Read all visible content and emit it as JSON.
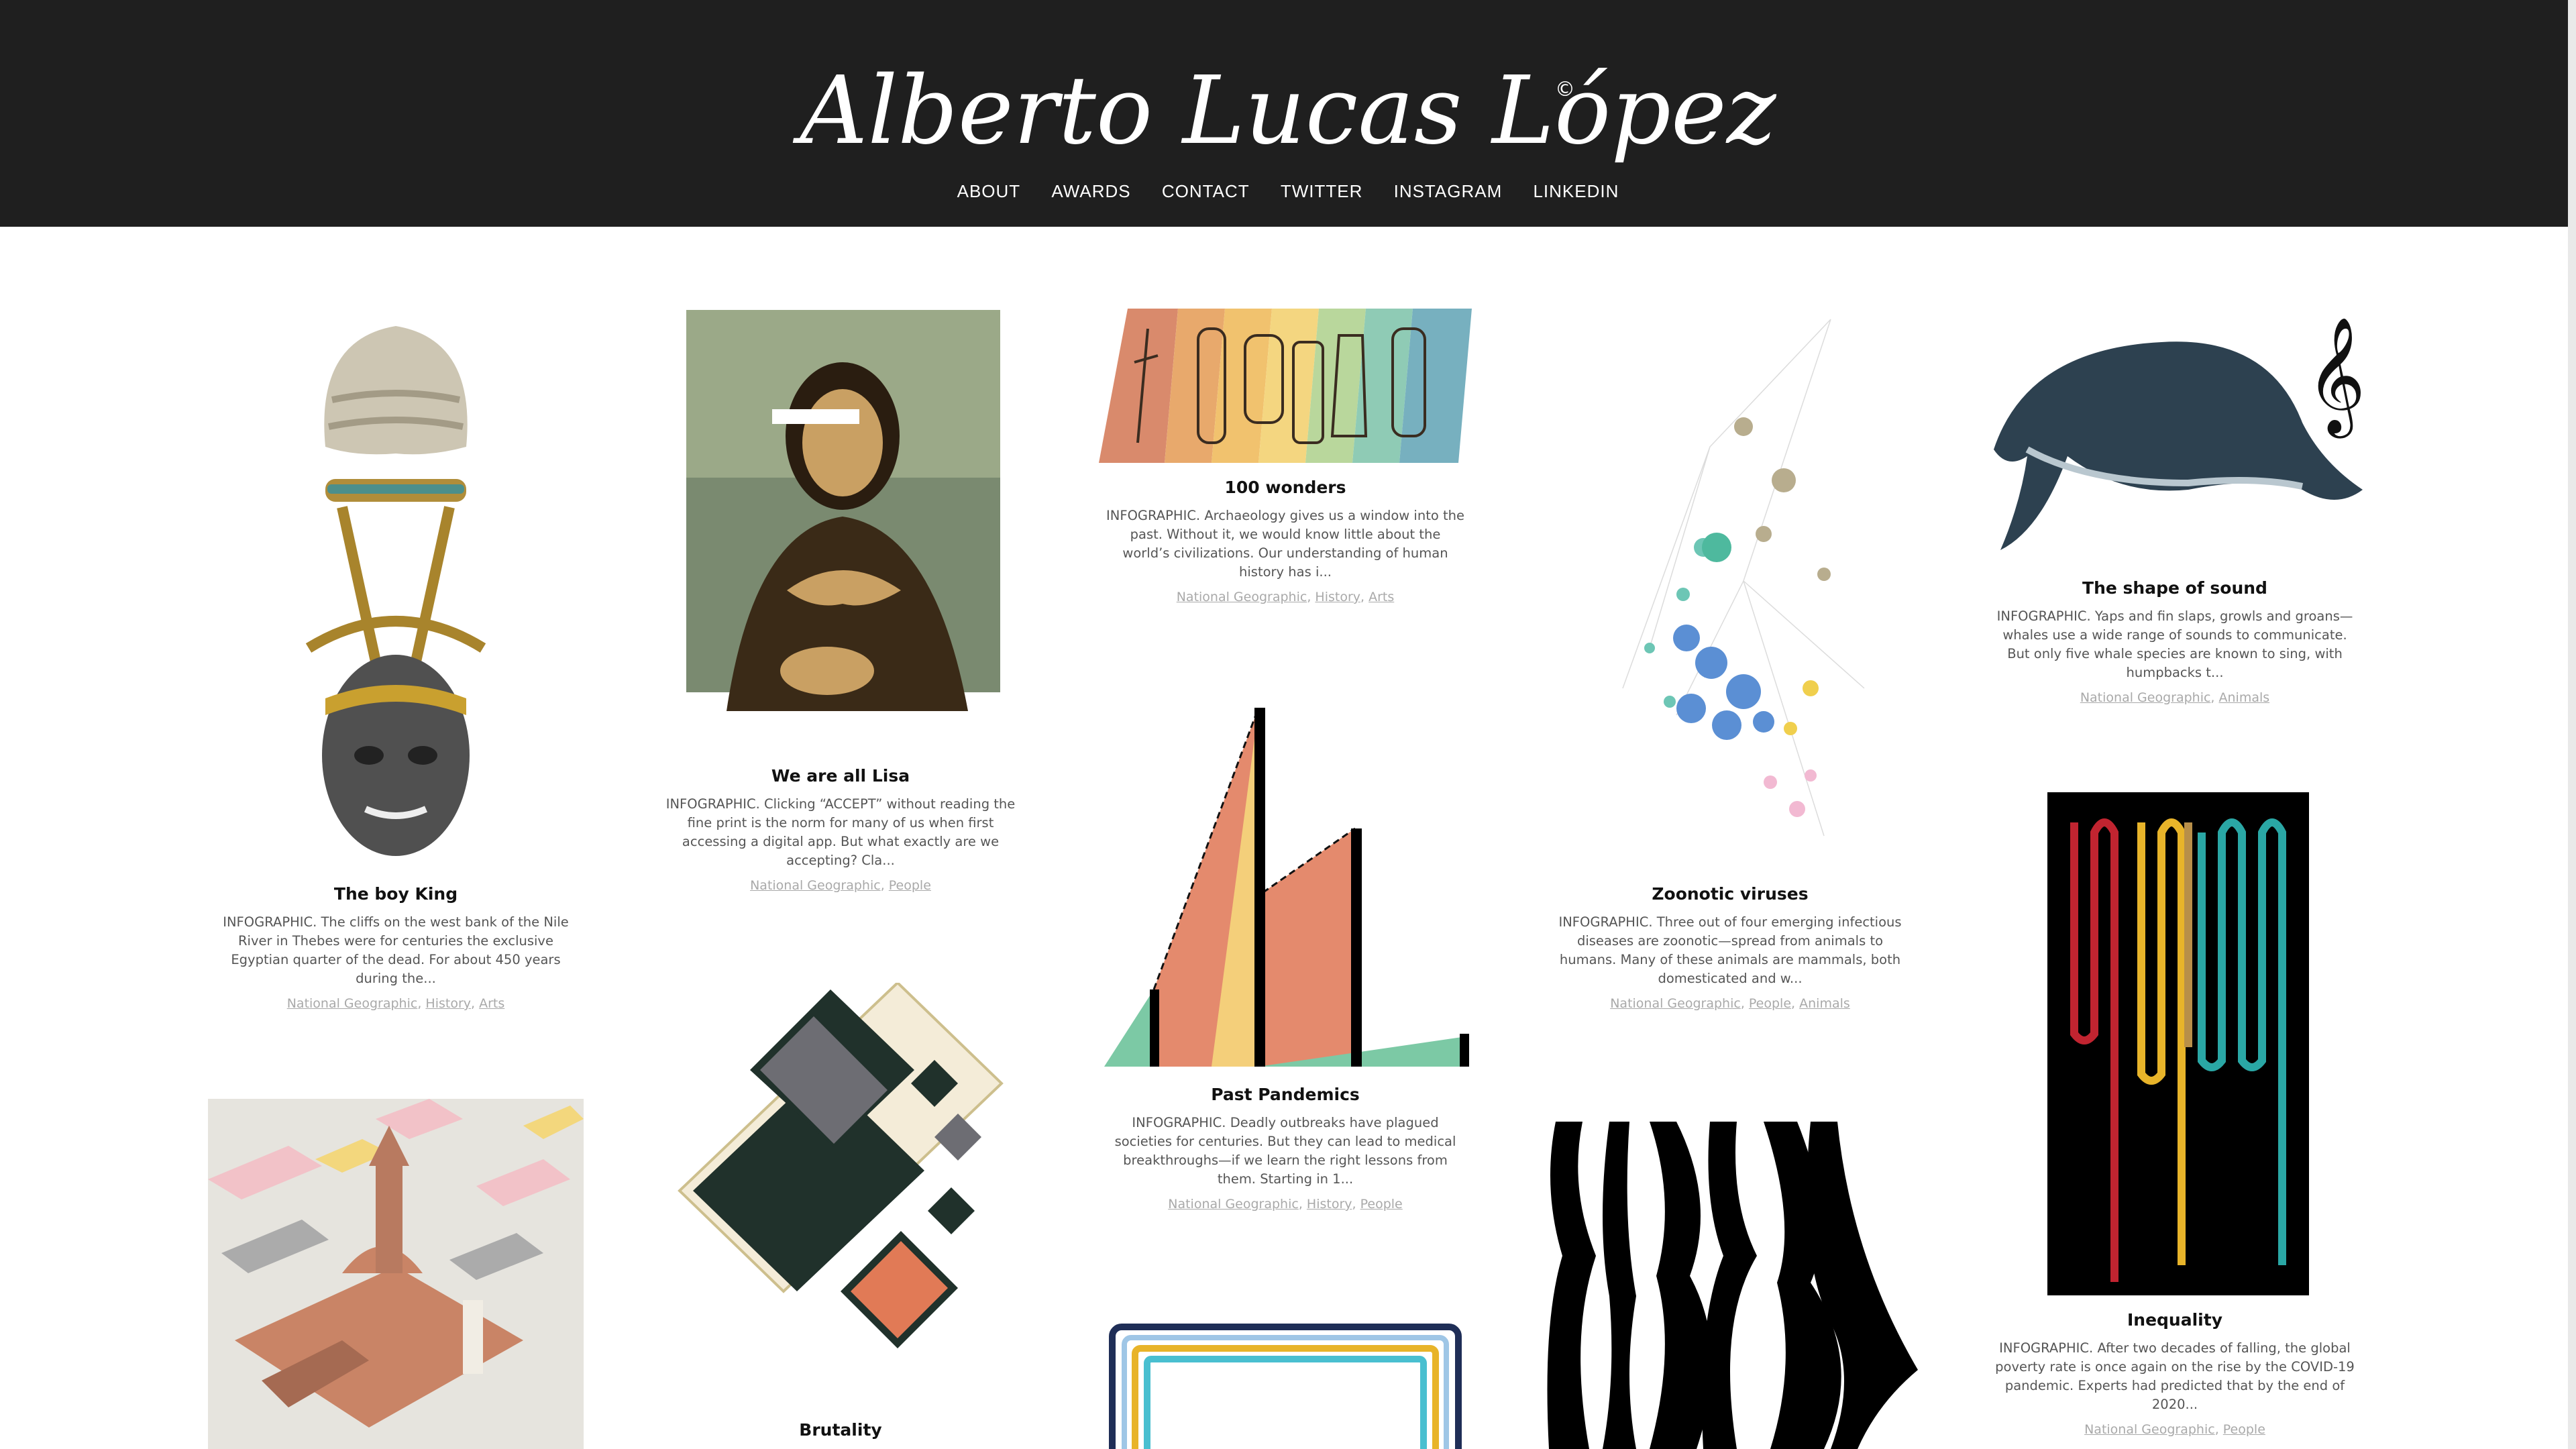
{
  "site": {
    "logo_text": "Alberto Lucas López",
    "copyright": "©",
    "nav": [
      "ABOUT",
      "AWARDS",
      "CONTACT",
      "TWITTER",
      "INSTAGRAM",
      "LINKEDIN"
    ]
  },
  "colors": {
    "header_bg": "#1f1f1f",
    "tag_link": "#a9a9a9",
    "title": "#111111"
  },
  "cards": [
    {
      "title": "The boy King",
      "desc": "INFOGRAPHIC. The cliffs on the west bank of the Nile River in Thebes were for centuries the exclusive Egyptian quarter of the dead. For about 450 years during the...",
      "tags": [
        "National Geographic",
        "History",
        "Arts"
      ]
    },
    {
      "title": "We are all Lisa",
      "desc": "INFOGRAPHIC. Clicking “ACCEPT” without reading the fine print is the norm for many of us when first accessing a digital app. But what exactly are we accepting? Cla...",
      "tags": [
        "National Geographic",
        "People"
      ]
    },
    {
      "title": "100 wonders",
      "desc": "INFOGRAPHIC. Archaeology gives us a window into the past. Without it, we would know little about the world’s civilizations. Our understanding of human history has i...",
      "tags": [
        "National Geographic",
        "History",
        "Arts"
      ]
    },
    {
      "title": "Zoonotic viruses",
      "desc": "INFOGRAPHIC. Three out of four emerging infectious diseases are zoonotic—spread from animals to humans. Many of these animals are mammals, both domesticated and w...",
      "tags": [
        "National Geographic",
        "People",
        "Animals"
      ]
    },
    {
      "title": "The shape of sound",
      "desc": "INFOGRAPHIC. Yaps and fin slaps, growls and groans—whales use a wide range of sounds to communicate. But only five whale species are known to sing, with humpbacks t...",
      "tags": [
        "National Geographic",
        "Animals"
      ]
    },
    {
      "title": "Past Pandemics",
      "desc": "INFOGRAPHIC. Deadly outbreaks have plagued societies for centuries. But they can lead to medical breakthroughs—if we learn the right lessons from them. Starting in 1...",
      "tags": [
        "National Geographic",
        "History",
        "People"
      ]
    },
    {
      "title": "Inequality",
      "desc": "INFOGRAPHIC. After two decades of falling, the global poverty rate is once again on the rise by the COVID-19 pandemic. Experts had predicted that by the end of 2020...",
      "tags": [
        "National Geographic",
        "People"
      ]
    },
    {
      "title": "Brutality"
    }
  ]
}
